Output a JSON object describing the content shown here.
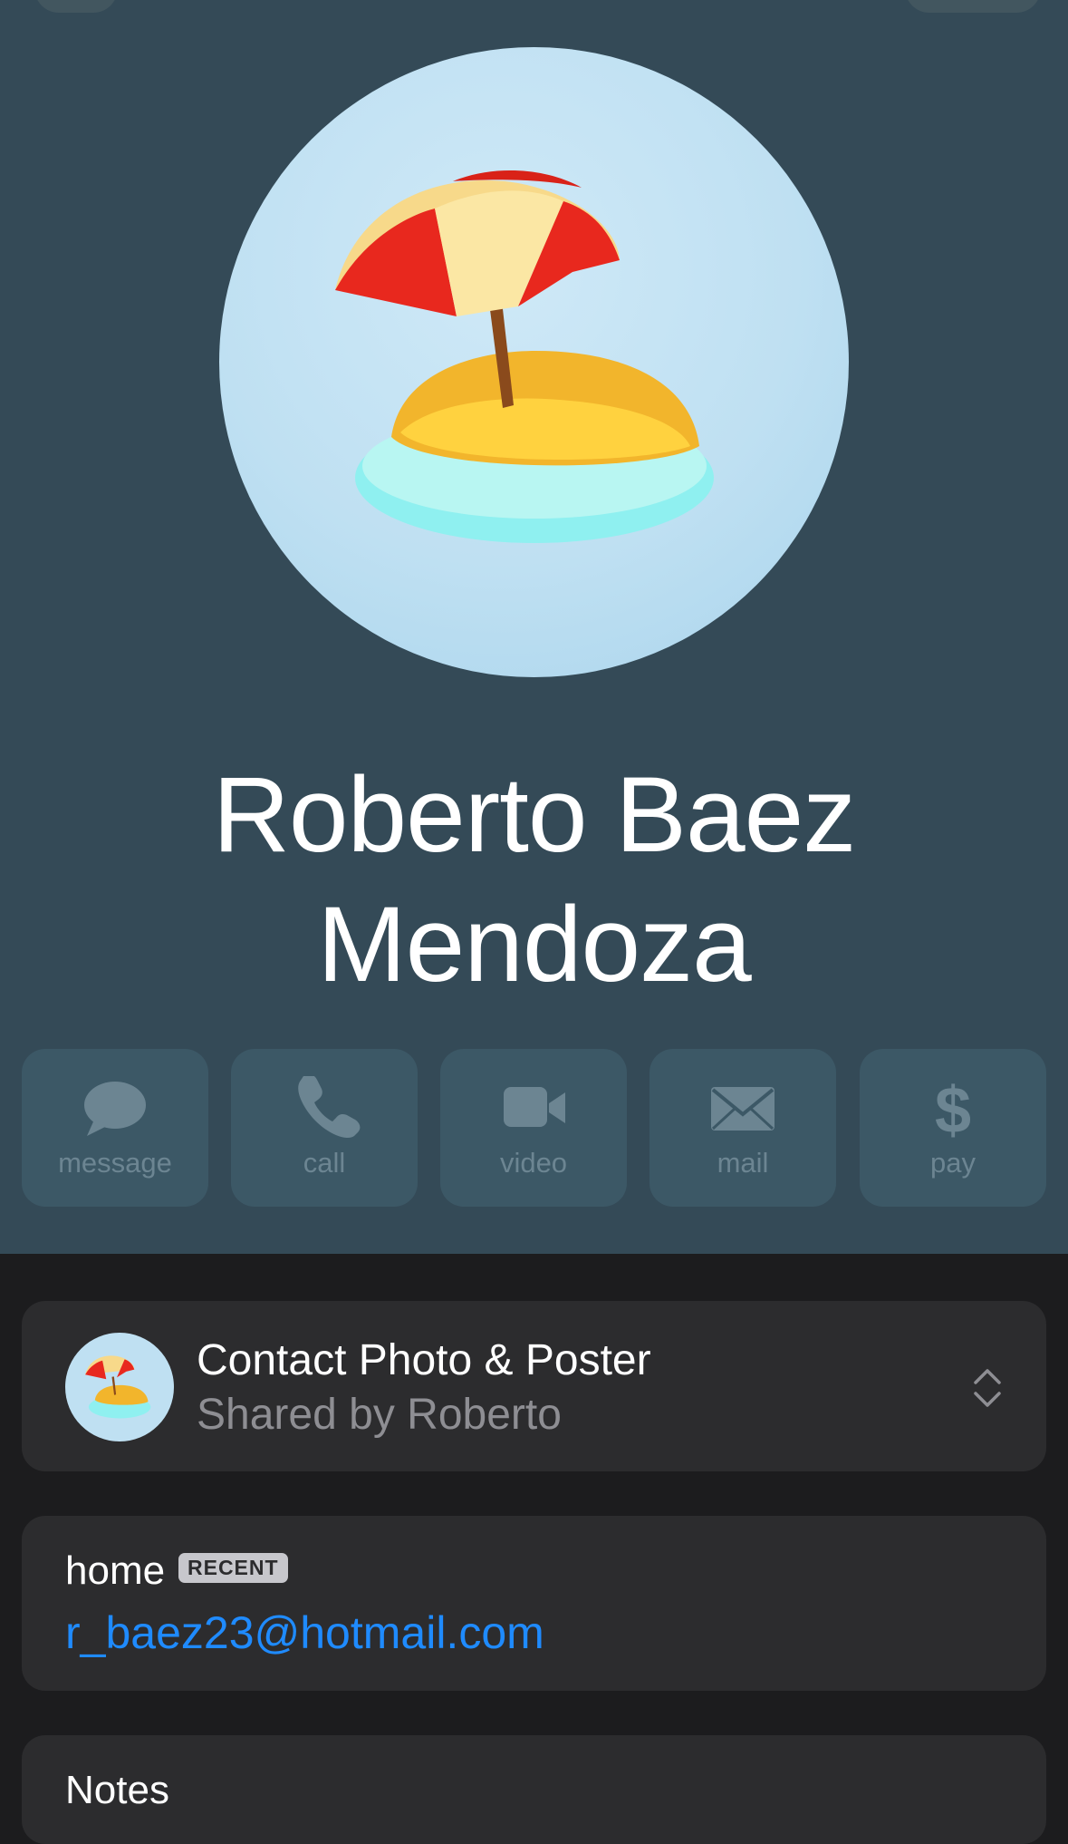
{
  "contact": {
    "name_line1": "Roberto Baez",
    "name_line2": "Mendoza",
    "avatar_icon": "beach-island-umbrella-emoji"
  },
  "actions": [
    {
      "label": "message",
      "icon": "message-bubble-icon"
    },
    {
      "label": "call",
      "icon": "phone-icon"
    },
    {
      "label": "video",
      "icon": "video-camera-icon"
    },
    {
      "label": "mail",
      "icon": "envelope-icon"
    },
    {
      "label": "pay",
      "icon": "dollar-icon"
    }
  ],
  "poster": {
    "title": "Contact Photo & Poster",
    "subtitle": "Shared by Roberto"
  },
  "email": {
    "label": "home",
    "badge": "RECENT",
    "value": "r_baez23@hotmail.com"
  },
  "notes": {
    "label": "Notes"
  },
  "colors": {
    "hero_background": "#344a57",
    "page_background": "#1c1c1e",
    "card_background": "#2c2c2e",
    "link_blue": "#1f8bff"
  }
}
